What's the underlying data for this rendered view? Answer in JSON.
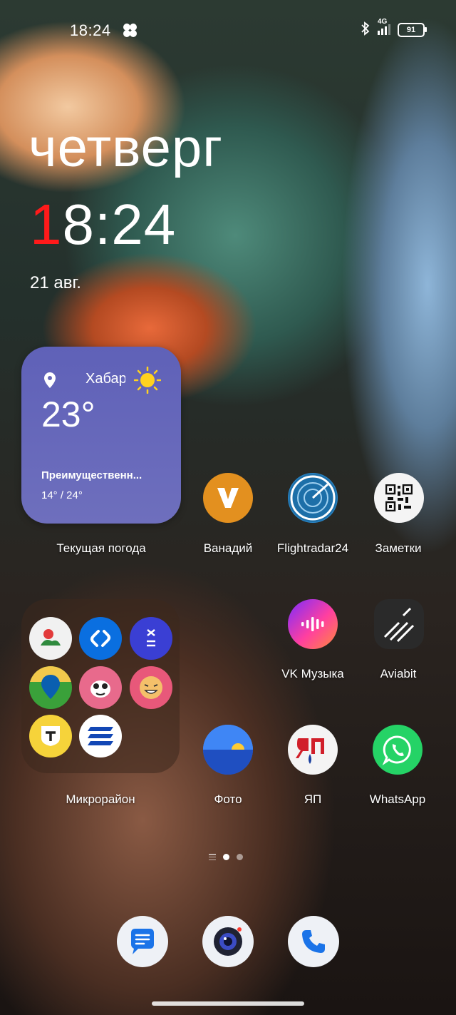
{
  "status_bar": {
    "time": "18:24",
    "network": "4G",
    "battery": "91"
  },
  "clock_widget": {
    "day": "четверг",
    "time_first_digit": "1",
    "time_rest": "8:24",
    "date": "21 авг."
  },
  "weather_widget": {
    "city": "Хабар",
    "temperature": "23°",
    "condition": "Преимущественн...",
    "range": "14° / 24°",
    "label": "Текущая погода"
  },
  "apps": {
    "vanadiy": "Ванадий",
    "flightradar": "Flightradar24",
    "zametki": "Заметки",
    "vk_music": "VK Музыка",
    "aviabit": "Aviabit",
    "foto": "Фото",
    "yap": "ЯП",
    "whatsapp": "WhatsApp"
  },
  "folder": {
    "label": "Микрорайон"
  },
  "dock": [
    "messages-icon",
    "camera-icon",
    "phone-icon"
  ],
  "colors": {
    "weather_bg": "#6566b9",
    "vanadiy": "#e0901f",
    "whatsapp": "#25d366",
    "clock_accent": "#ff1a1a"
  }
}
